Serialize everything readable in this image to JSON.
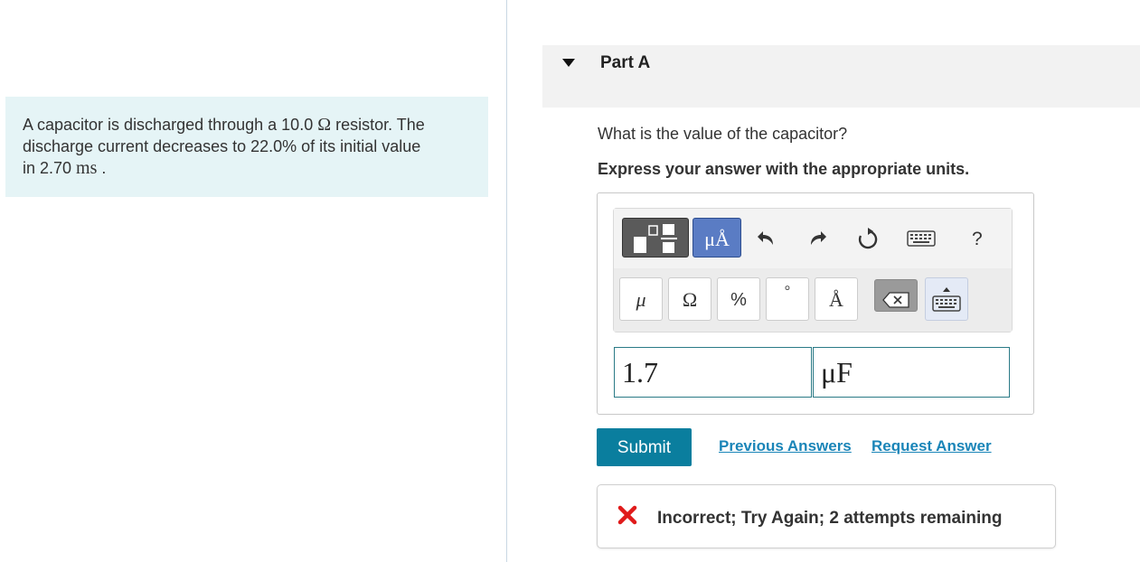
{
  "problem": {
    "line1_pre": "A capacitor is discharged through a 10.0 ",
    "resistance_unit": "Ω",
    "line1_post": " resistor. The",
    "line2": "discharge current decreases to 22.0% of its initial value",
    "line3_pre": "in 2.70 ",
    "time_unit": "ms",
    "line3_post": " ."
  },
  "part": {
    "title": "Part A"
  },
  "question": {
    "prompt": "What is the value of the capacitor?",
    "instruction": "Express your answer with the appropriate units."
  },
  "toolbar": {
    "units_button": "μÅ",
    "help": "?",
    "symbols": [
      "μ",
      "Ω",
      "%",
      "°",
      "Å"
    ],
    "icons": [
      "templates-icon",
      "units-icon",
      "undo-icon",
      "redo-icon",
      "reset-icon",
      "keyboard-icon",
      "help-icon",
      "backspace-icon",
      "keyboard-toggle-icon"
    ]
  },
  "answer": {
    "value": "1.7",
    "unit": "μF"
  },
  "actions": {
    "submit": "Submit",
    "previous_answers": "Previous Answers",
    "request_answer": "Request Answer"
  },
  "feedback": {
    "message": "Incorrect; Try Again; 2 attempts remaining",
    "status_color": "#e01b1b"
  },
  "colors": {
    "accent": "#0a7e9e",
    "link": "#1a85b8",
    "problem_bg": "#e5f4f6",
    "units_btn": "#5a7cc4"
  }
}
